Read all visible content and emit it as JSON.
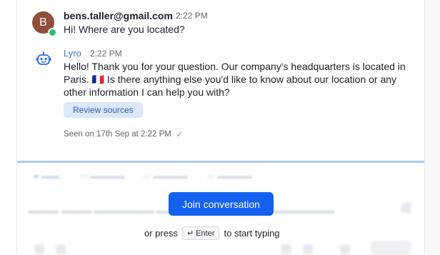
{
  "conversation": {
    "user_message": {
      "avatar_initial": "B",
      "sender": "bens.taller@gmail.com",
      "time": "2:22 PM",
      "text": "Hi! Where are you located?"
    },
    "bot_message": {
      "sender": "Lyro",
      "time": "2:22 PM",
      "text": "Hello! Thank you for your question. Our company's headquarters is located in Paris. 🇫🇷 Is there anything else you'd like to know about our location or any other information I can help you with?",
      "review_button": "Review sources",
      "seen_status": "Seen on 17th Sep at 2:22 PM"
    }
  },
  "composer": {
    "join_button": "Join conversation",
    "hint_prefix": "or press",
    "hint_key": "Enter",
    "hint_suffix": "to start typing"
  },
  "colors": {
    "accent": "#1560ee",
    "online": "#25c16f",
    "bot_name": "#3a7bd5",
    "chip_bg": "#dbe7fb"
  }
}
